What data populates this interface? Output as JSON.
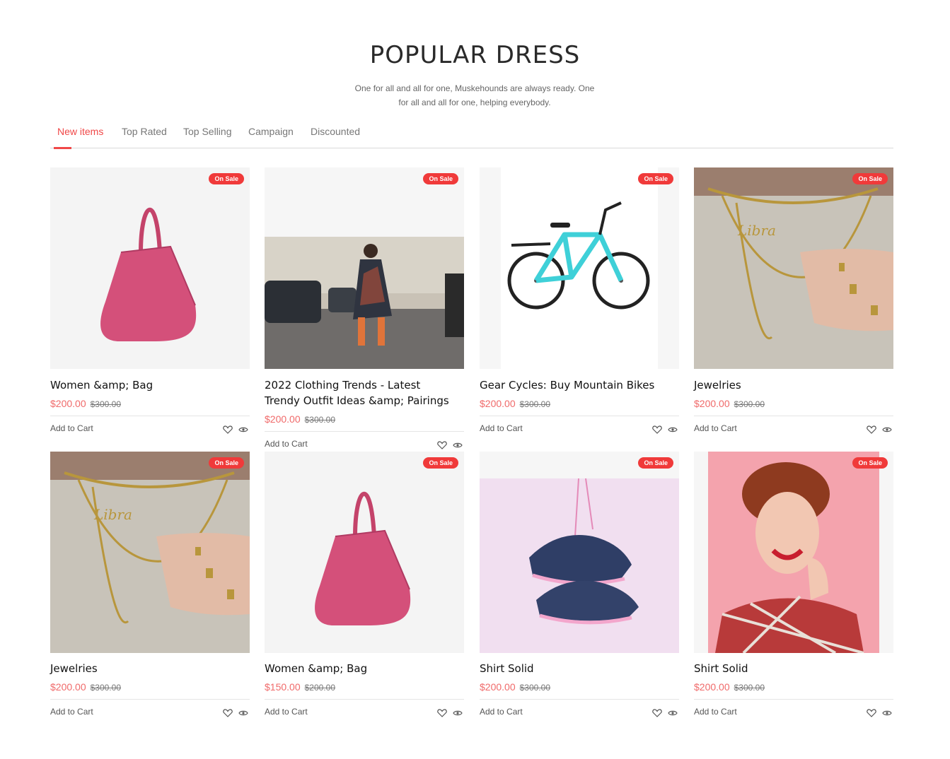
{
  "section": {
    "title": "POPULAR DRESS",
    "subtitle": "One for all and all for one, Muskehounds are always ready. One for all and all for one, helping everybody."
  },
  "tabs": [
    {
      "label": "New items",
      "active": true
    },
    {
      "label": "Top Rated",
      "active": false
    },
    {
      "label": "Top Selling",
      "active": false
    },
    {
      "label": "Campaign",
      "active": false
    },
    {
      "label": "Discounted",
      "active": false
    }
  ],
  "badge_label": "On Sale",
  "add_to_cart_label": "Add to Cart",
  "colors": {
    "accent": "#f04848",
    "badge": "#f03a3a",
    "price": "#f06a6a"
  },
  "products": [
    {
      "name": "Women &amp; Bag",
      "price": "$200.00",
      "old_price": "$300.00",
      "image": "pink-suede-tote-bag"
    },
    {
      "name": "2022 Clothing Trends - Latest Trendy Outfit Ideas &amp; Pairings",
      "price": "$200.00",
      "old_price": "$300.00",
      "image": "woman-street-style-floral-dress"
    },
    {
      "name": "Gear Cycles: Buy Mountain Bikes",
      "price": "$200.00",
      "old_price": "$300.00",
      "image": "teal-mountain-bike"
    },
    {
      "name": "Jewelries",
      "price": "$200.00",
      "old_price": "$300.00",
      "image": "gold-necklaces-and-rings"
    },
    {
      "name": "Jewelries",
      "price": "$200.00",
      "old_price": "$300.00",
      "image": "gold-necklaces-and-rings"
    },
    {
      "name": "Women &amp; Bag",
      "price": "$150.00",
      "old_price": "$200.00",
      "image": "pink-suede-tote-bag"
    },
    {
      "name": "Shirt Solid",
      "price": "$200.00",
      "old_price": "$300.00",
      "image": "navy-pink-sneakers"
    },
    {
      "name": "Shirt Solid",
      "price": "$200.00",
      "old_price": "$300.00",
      "image": "pinup-woman-red-hair"
    }
  ]
}
